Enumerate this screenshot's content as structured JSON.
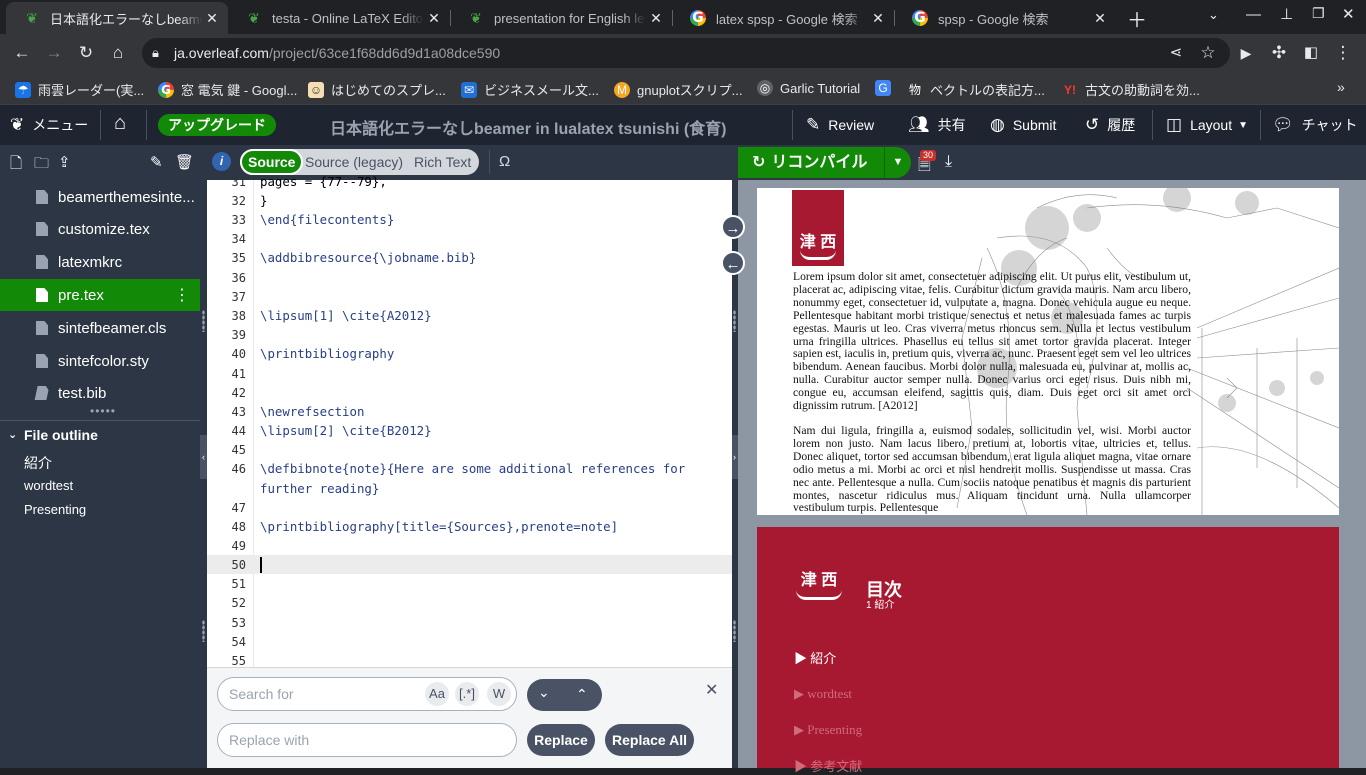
{
  "browser": {
    "tabs": [
      {
        "title": "日本語化エラーなしbeamer in lualatex tsunishi (食育) - Online LaTeX Editor Overleaf",
        "icon": "overleaf-icon"
      },
      {
        "title": "testa - Online LaTeX Editor Overleaf",
        "icon": "overleaf-icon"
      },
      {
        "title": "presentation for English lesson",
        "icon": "overleaf-icon"
      },
      {
        "title": "latex spsp - Google 検索",
        "icon": "google-icon"
      },
      {
        "title": "spsp - Google 検索",
        "icon": "google-icon"
      }
    ],
    "url_host": "ja.overleaf.com",
    "url_path": "/project/63ce1f68dd6d9d1a08dce590",
    "bookmarks": [
      "雨雲レーダー(実...",
      "窓 電気 鍵 - Googl...",
      "はじめてのスプレ...",
      "ビジネスメール文...",
      "gnuplotスクリプ...",
      "Garlic Tutorial",
      "",
      "ベクトルの表記方...",
      "古文の助動詞を効..."
    ]
  },
  "header": {
    "menu": "メニュー",
    "upgrade": "アップグレード",
    "project_title": "日本語化エラーなしbeamer in lualatex tsunishi (食育)",
    "review": "Review",
    "share": "共有",
    "submit": "Submit",
    "history": "履歴",
    "layout": "Layout",
    "chat": "チャット"
  },
  "files": [
    {
      "name": "beamerthemesinte...",
      "selected": false
    },
    {
      "name": "customize.tex",
      "selected": false
    },
    {
      "name": "latexmkrc",
      "selected": false
    },
    {
      "name": "pre.tex",
      "selected": true
    },
    {
      "name": "sintefbeamer.cls",
      "selected": false
    },
    {
      "name": "sintefcolor.sty",
      "selected": false
    },
    {
      "name": "test.bib",
      "selected": false
    }
  ],
  "outline": {
    "title": "File outline",
    "items": [
      "紹介",
      "wordtest",
      "Presenting"
    ]
  },
  "editor": {
    "modes": [
      "Source",
      "Source (legacy)",
      "Rich Text"
    ],
    "omega": "Ω",
    "line_numbers": [
      "31",
      "32",
      "33",
      "34",
      "35",
      "36",
      "37",
      "38",
      "39",
      "40",
      "41",
      "42",
      "43",
      "44",
      "45",
      "46",
      "",
      "47",
      "48",
      "49",
      "50",
      "51",
      "52",
      "53",
      "54",
      "55"
    ],
    "lines": [
      "pages = {77--79},",
      "}",
      "\\end{filecontents}",
      "",
      "\\addbibresource{\\jobname.bib}",
      "",
      "",
      "\\lipsum[1] \\cite{A2012}",
      "",
      "\\printbibliography",
      "",
      "",
      "\\newrefsection",
      "\\lipsum[2] \\cite{B2012}",
      "",
      "\\defbibnote{note}{Here are some additional references for",
      "further reading}",
      "",
      "\\printbibliography[title={Sources},prenote=note]",
      "",
      "",
      "",
      "",
      "",
      "",
      ""
    ]
  },
  "search": {
    "search_placeholder": "Search for",
    "replace_placeholder": "Replace with",
    "opt_case": "Aa",
    "opt_regex": "[.*]",
    "opt_word": "W",
    "replace": "Replace",
    "replace_all": "Replace All"
  },
  "pdf": {
    "recompile": "リコンパイル",
    "badge": "30",
    "page1_para1": "Lorem ipsum dolor sit amet, consectetuer adipiscing elit. Ut purus elit, vestibulum ut, placerat ac, adipiscing vitae, felis. Curabitur dictum gravida mauris. Nam arcu libero, nonummy eget, consectetuer id, vulputate a, magna. Donec vehicula augue eu neque. Pellentesque habitant morbi tristique senectus et netus et malesuada fames ac turpis egestas. Mauris ut leo. Cras viverra metus rhoncus sem. Nulla et lectus vestibulum urna fringilla ultrices. Phasellus eu tellus sit amet tortor gravida placerat. Integer sapien est, iaculis in, pretium quis, viverra ac, nunc. Praesent eget sem vel leo ultrices bibendum. Aenean faucibus. Morbi dolor nulla, malesuada eu, pulvinar at, mollis ac, nulla. Curabitur auctor semper nulla. Donec varius orci eget risus. Duis nibh mi, congue eu, accumsan eleifend, sagittis quis, diam. Duis eget orci sit amet orci dignissim rutrum. [A2012]",
    "page1_para2": "Nam dui ligula, fringilla a, euismod sodales, sollicitudin vel, wisi. Morbi auctor lorem non justo. Nam lacus libero, pretium at, lobortis vitae, ultricies et, tellus. Donec aliquet, tortor sed accumsan bibendum, erat ligula aliquet magna, vitae ornare odio metus a mi. Morbi ac orci et nisl hendrerit mollis. Suspendisse ut massa. Cras nec ante. Pellentesque a nulla. Cum sociis natoque penatibus et magnis dis parturient montes, nascetur ridiculus mus. Aliquam tincidunt urna. Nulla ullamcorper vestibulum turpis. Pellentesque",
    "logo_text": "津 西",
    "toc_title": "目次",
    "toc_sub": "1  紹介",
    "toc_items": [
      "紹介",
      "wordtest",
      "Presenting",
      "参考文献"
    ]
  },
  "colors": {
    "overleaf_green": "#138a07",
    "header_bg": "#1e2530",
    "panel_bg": "#2c3645",
    "slide_red": "#a71930"
  }
}
